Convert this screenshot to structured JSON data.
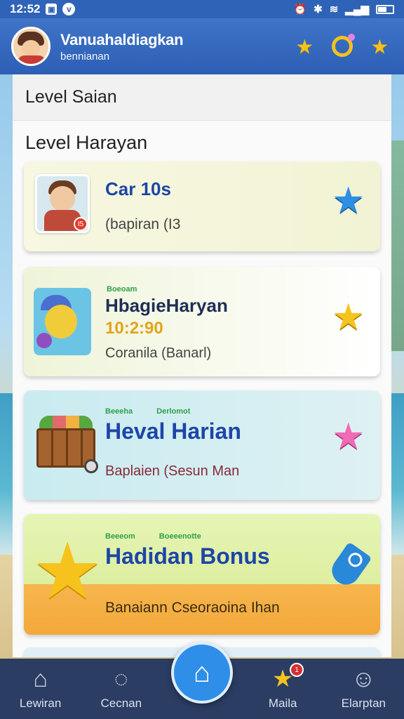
{
  "status_bar": {
    "time": "12:52",
    "app_icon_1": "app-icon",
    "app_icon_2": "v-icon",
    "system_icons": [
      "alarm-icon",
      "bluetooth-icon",
      "wifi-icon",
      "signal-icon",
      "battery-icon"
    ]
  },
  "header": {
    "title": "Vanuahaldiagkan",
    "subtitle": "bennianan",
    "icons": [
      "star-icon",
      "gear-icon",
      "star-icon"
    ],
    "accent_color": "#2c5fb5"
  },
  "section": {
    "title": "Level Saian",
    "subtitle": "Level Harayan"
  },
  "cards": [
    {
      "title": "Car 10s",
      "subtitle": "(bapiran (I3",
      "badge": "I5",
      "star_color": "#2d8fe4"
    },
    {
      "tag": "Boeoam",
      "title": "HbagieHaryan",
      "time": "10:2:90",
      "subtitle": "Coranila (Banarl)",
      "star_color": "#f5c41e"
    },
    {
      "tags": [
        "Beeeha",
        "Derlomot"
      ],
      "title": "Heval Harian",
      "subtitle": "Baplaien (Sesun Man",
      "star_color": "#f06ab5"
    },
    {
      "tags": [
        "Beeeom",
        "Boeeenotte"
      ],
      "title": "Hadidan Bonus",
      "subtitle": "Banaiann Cseoraoina Ihan"
    }
  ],
  "bottom_nav": {
    "items": [
      {
        "label": "Lewiran",
        "icon": "home-icon"
      },
      {
        "label": "Cecnan",
        "icon": "chat-icon"
      },
      {
        "label": "Home",
        "icon": "home-center-icon"
      },
      {
        "label": "Maila",
        "icon": "star-icon",
        "badge": "1"
      },
      {
        "label": "Elarptan",
        "icon": "profile-icon"
      }
    ]
  }
}
